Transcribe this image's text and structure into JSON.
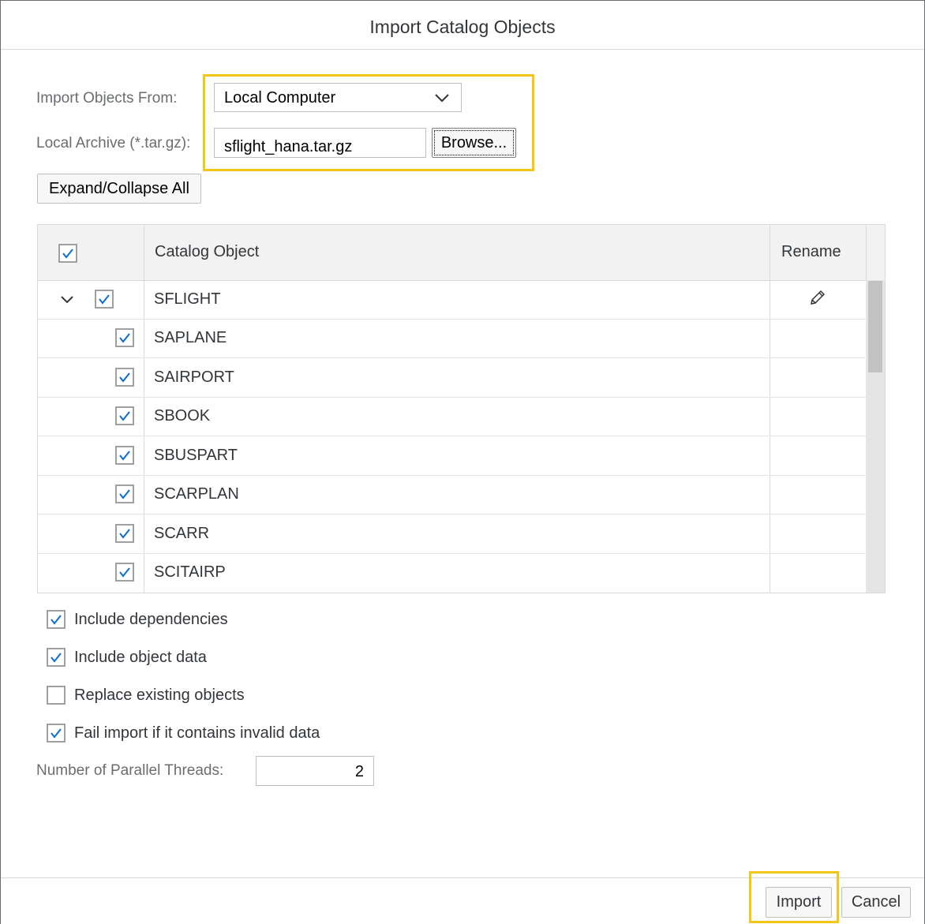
{
  "dialog": {
    "title": "Import Catalog Objects"
  },
  "form": {
    "import_from_label": "Import Objects From:",
    "import_from_value": "Local Computer",
    "archive_label": "Local Archive (*.tar.gz):",
    "archive_value": "sflight_hana.tar.gz",
    "browse_label": "Browse...",
    "expand_collapse_label": "Expand/Collapse All"
  },
  "table": {
    "columns": [
      "Catalog Object",
      "Rename"
    ],
    "header_checked": true,
    "schema": {
      "name": "SFLIGHT",
      "checked": true,
      "expanded": true
    },
    "rows": [
      {
        "name": "SAPLANE",
        "checked": true
      },
      {
        "name": "SAIRPORT",
        "checked": true
      },
      {
        "name": "SBOOK",
        "checked": true
      },
      {
        "name": "SBUSPART",
        "checked": true
      },
      {
        "name": "SCARPLAN",
        "checked": true
      },
      {
        "name": "SCARR",
        "checked": true
      },
      {
        "name": "SCITAIRP",
        "checked": true
      }
    ]
  },
  "options": [
    {
      "label": "Include dependencies",
      "checked": true
    },
    {
      "label": "Include object data",
      "checked": true
    },
    {
      "label": "Replace existing objects",
      "checked": false
    },
    {
      "label": "Fail import if it contains invalid data",
      "checked": true
    }
  ],
  "threads": {
    "label": "Number of Parallel Threads:",
    "value": "2"
  },
  "footer": {
    "import_label": "Import",
    "cancel_label": "Cancel"
  },
  "colors": {
    "highlight": "#f5c518",
    "checkmark": "#0a6ed1"
  }
}
